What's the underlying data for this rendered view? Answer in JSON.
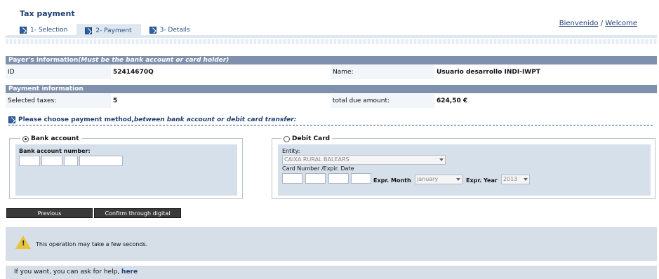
{
  "app": {
    "title": "Tax payment"
  },
  "tabs": [
    {
      "label": "1- Selection"
    },
    {
      "label": "2- Payment"
    },
    {
      "label": "3- Details"
    }
  ],
  "user": {
    "greeting": "Bienvenido",
    "separator": "/",
    "welcome": "Welcome"
  },
  "payer": {
    "header": "Payer's information",
    "header_note": "(Must be the bank account or card holder)",
    "id_label": "ID",
    "id_value": "52414670Q",
    "name_label": "Name:",
    "name_value": "Usuario desarrollo INDI-IWPT"
  },
  "payment": {
    "header": "Payment information",
    "selected_label": "Selected taxes:",
    "selected_value": "5",
    "total_label": "total due amount:",
    "total_value": "624,50 €"
  },
  "method": {
    "prompt_start": "Please choose payment method,",
    "prompt_italic": "between bank account or debit card transfer:"
  },
  "bank": {
    "title": "Bank account",
    "selected": true,
    "number_label": "Bank account number:"
  },
  "card": {
    "title": "Debit Card",
    "selected": false,
    "entity_label": "Entity:",
    "entity_value": "CAIXA RURAL BALEARS",
    "number_label": "Card Number /Expir. Date",
    "month_label": "Expr. Month",
    "month_value": "january",
    "year_label": "Expr. Year",
    "year_value": "2013"
  },
  "buttons": {
    "previous": "Previous",
    "confirm": "Confirm through digital signature"
  },
  "notice": {
    "text": "This operation may take a few seconds."
  },
  "help": {
    "text": "If you want, you can ask for help, ",
    "link": "here"
  }
}
